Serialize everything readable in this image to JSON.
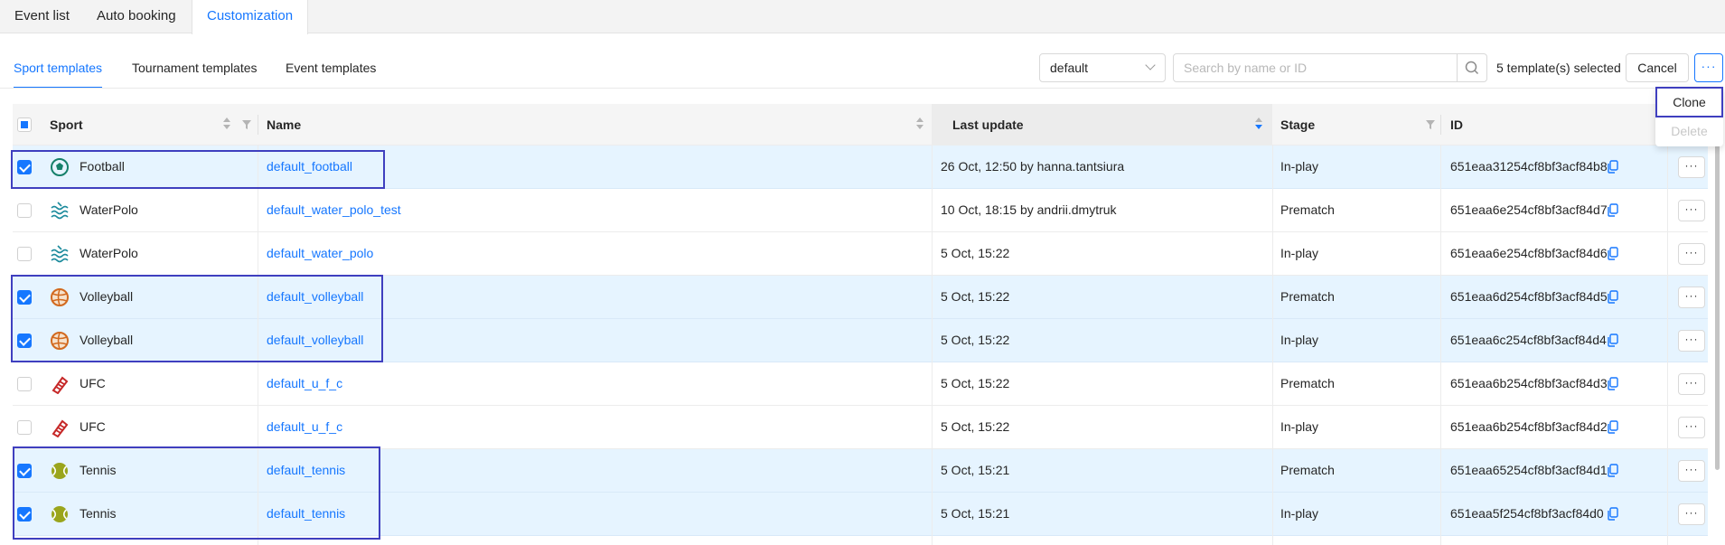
{
  "top_tabs": [
    "Event list",
    "Auto booking",
    "Customization"
  ],
  "sub_tabs": [
    "Sport templates",
    "Tournament templates",
    "Event templates"
  ],
  "toolbar": {
    "select_value": "default",
    "search_placeholder": "Search by name or ID",
    "selected_count": "5 template(s) selected",
    "cancel_label": "Cancel",
    "more_label": "···"
  },
  "dropdown": {
    "clone": "Clone",
    "delete": "Delete"
  },
  "columns": {
    "sport": "Sport",
    "name": "Name",
    "last_update": "Last update",
    "stage": "Stage",
    "id": "ID"
  },
  "rows": [
    {
      "checked": true,
      "sport": "Football",
      "icon": "football-icon",
      "name": "default_football",
      "last_update": "26 Oct, 12:50 by hanna.tantsiura",
      "stage": "In-play",
      "id": "651eaa31254cf8bf3acf84b8"
    },
    {
      "checked": false,
      "sport": "WaterPolo",
      "icon": "water-polo-icon",
      "name": "default_water_polo_test",
      "last_update": "10 Oct, 18:15 by andrii.dmytruk",
      "stage": "Prematch",
      "id": "651eaa6e254cf8bf3acf84d7"
    },
    {
      "checked": false,
      "sport": "WaterPolo",
      "icon": "water-polo-icon",
      "name": "default_water_polo",
      "last_update": "5 Oct, 15:22",
      "stage": "In-play",
      "id": "651eaa6e254cf8bf3acf84d6"
    },
    {
      "checked": true,
      "sport": "Volleyball",
      "icon": "volleyball-icon",
      "name": "default_volleyball",
      "last_update": "5 Oct, 15:22",
      "stage": "Prematch",
      "id": "651eaa6d254cf8bf3acf84d5"
    },
    {
      "checked": true,
      "sport": "Volleyball",
      "icon": "volleyball-icon",
      "name": "default_volleyball",
      "last_update": "5 Oct, 15:22",
      "stage": "In-play",
      "id": "651eaa6c254cf8bf3acf84d4"
    },
    {
      "checked": false,
      "sport": "UFC",
      "icon": "ufc-glove-icon",
      "name": "default_u_f_c",
      "last_update": "5 Oct, 15:22",
      "stage": "Prematch",
      "id": "651eaa6b254cf8bf3acf84d3"
    },
    {
      "checked": false,
      "sport": "UFC",
      "icon": "ufc-glove-icon",
      "name": "default_u_f_c",
      "last_update": "5 Oct, 15:22",
      "stage": "In-play",
      "id": "651eaa6b254cf8bf3acf84d2"
    },
    {
      "checked": true,
      "sport": "Tennis",
      "icon": "tennis-ball-icon",
      "name": "default_tennis",
      "last_update": "5 Oct, 15:21",
      "stage": "Prematch",
      "id": "651eaa65254cf8bf3acf84d1"
    },
    {
      "checked": true,
      "sport": "Tennis",
      "icon": "tennis-ball-icon",
      "name": "default_tennis",
      "last_update": "5 Oct, 15:21",
      "stage": "In-play",
      "id": "651eaa5f254cf8bf3acf84d0"
    }
  ],
  "colors": {
    "accent": "#1677ff",
    "selected_row": "#e6f4ff",
    "highlight_box": "#3f3fbf"
  }
}
